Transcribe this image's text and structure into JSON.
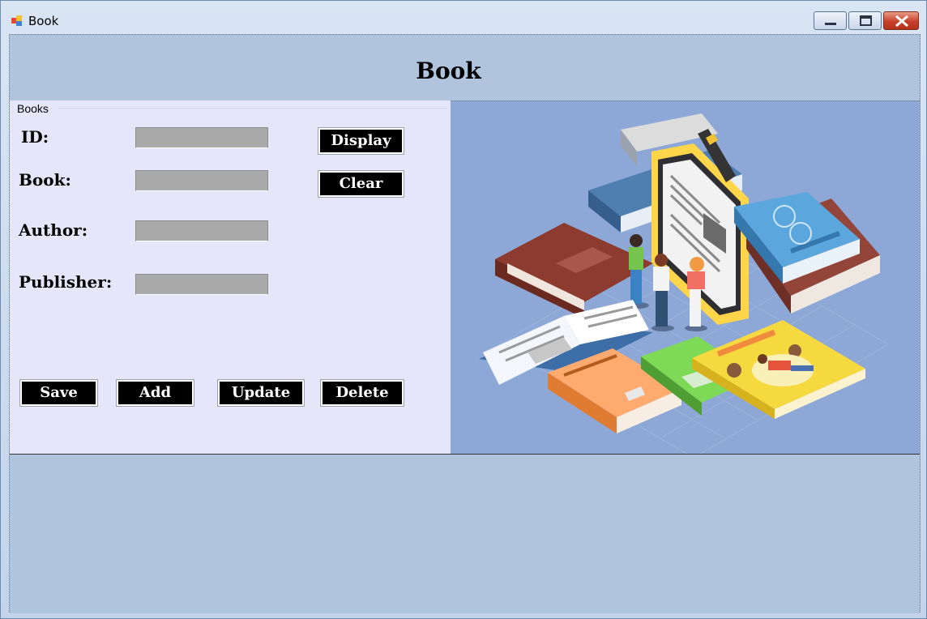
{
  "window": {
    "title": "Book",
    "controls": {
      "minimize": "minimize",
      "maximize": "maximize",
      "close": "close"
    }
  },
  "header": {
    "title": "Book"
  },
  "group": {
    "label": "Books",
    "fields": [
      {
        "label": "ID:",
        "value": ""
      },
      {
        "label": "Book:",
        "value": ""
      },
      {
        "label": "Author:",
        "value": ""
      },
      {
        "label": "Publisher:",
        "value": ""
      }
    ],
    "buttons": {
      "display": "Display",
      "clear": "Clear",
      "save": "Save",
      "add": "Add",
      "update": "Update",
      "delete": "Delete"
    }
  },
  "illustration": {
    "icon": "books-and-ereader-illustration"
  },
  "colors": {
    "client_bg": "#b0c4de",
    "group_bg": "#e6e6fa",
    "field_bg": "#a9a9a9",
    "button_bg": "#000000",
    "picture_bg": "#8da8d6"
  }
}
